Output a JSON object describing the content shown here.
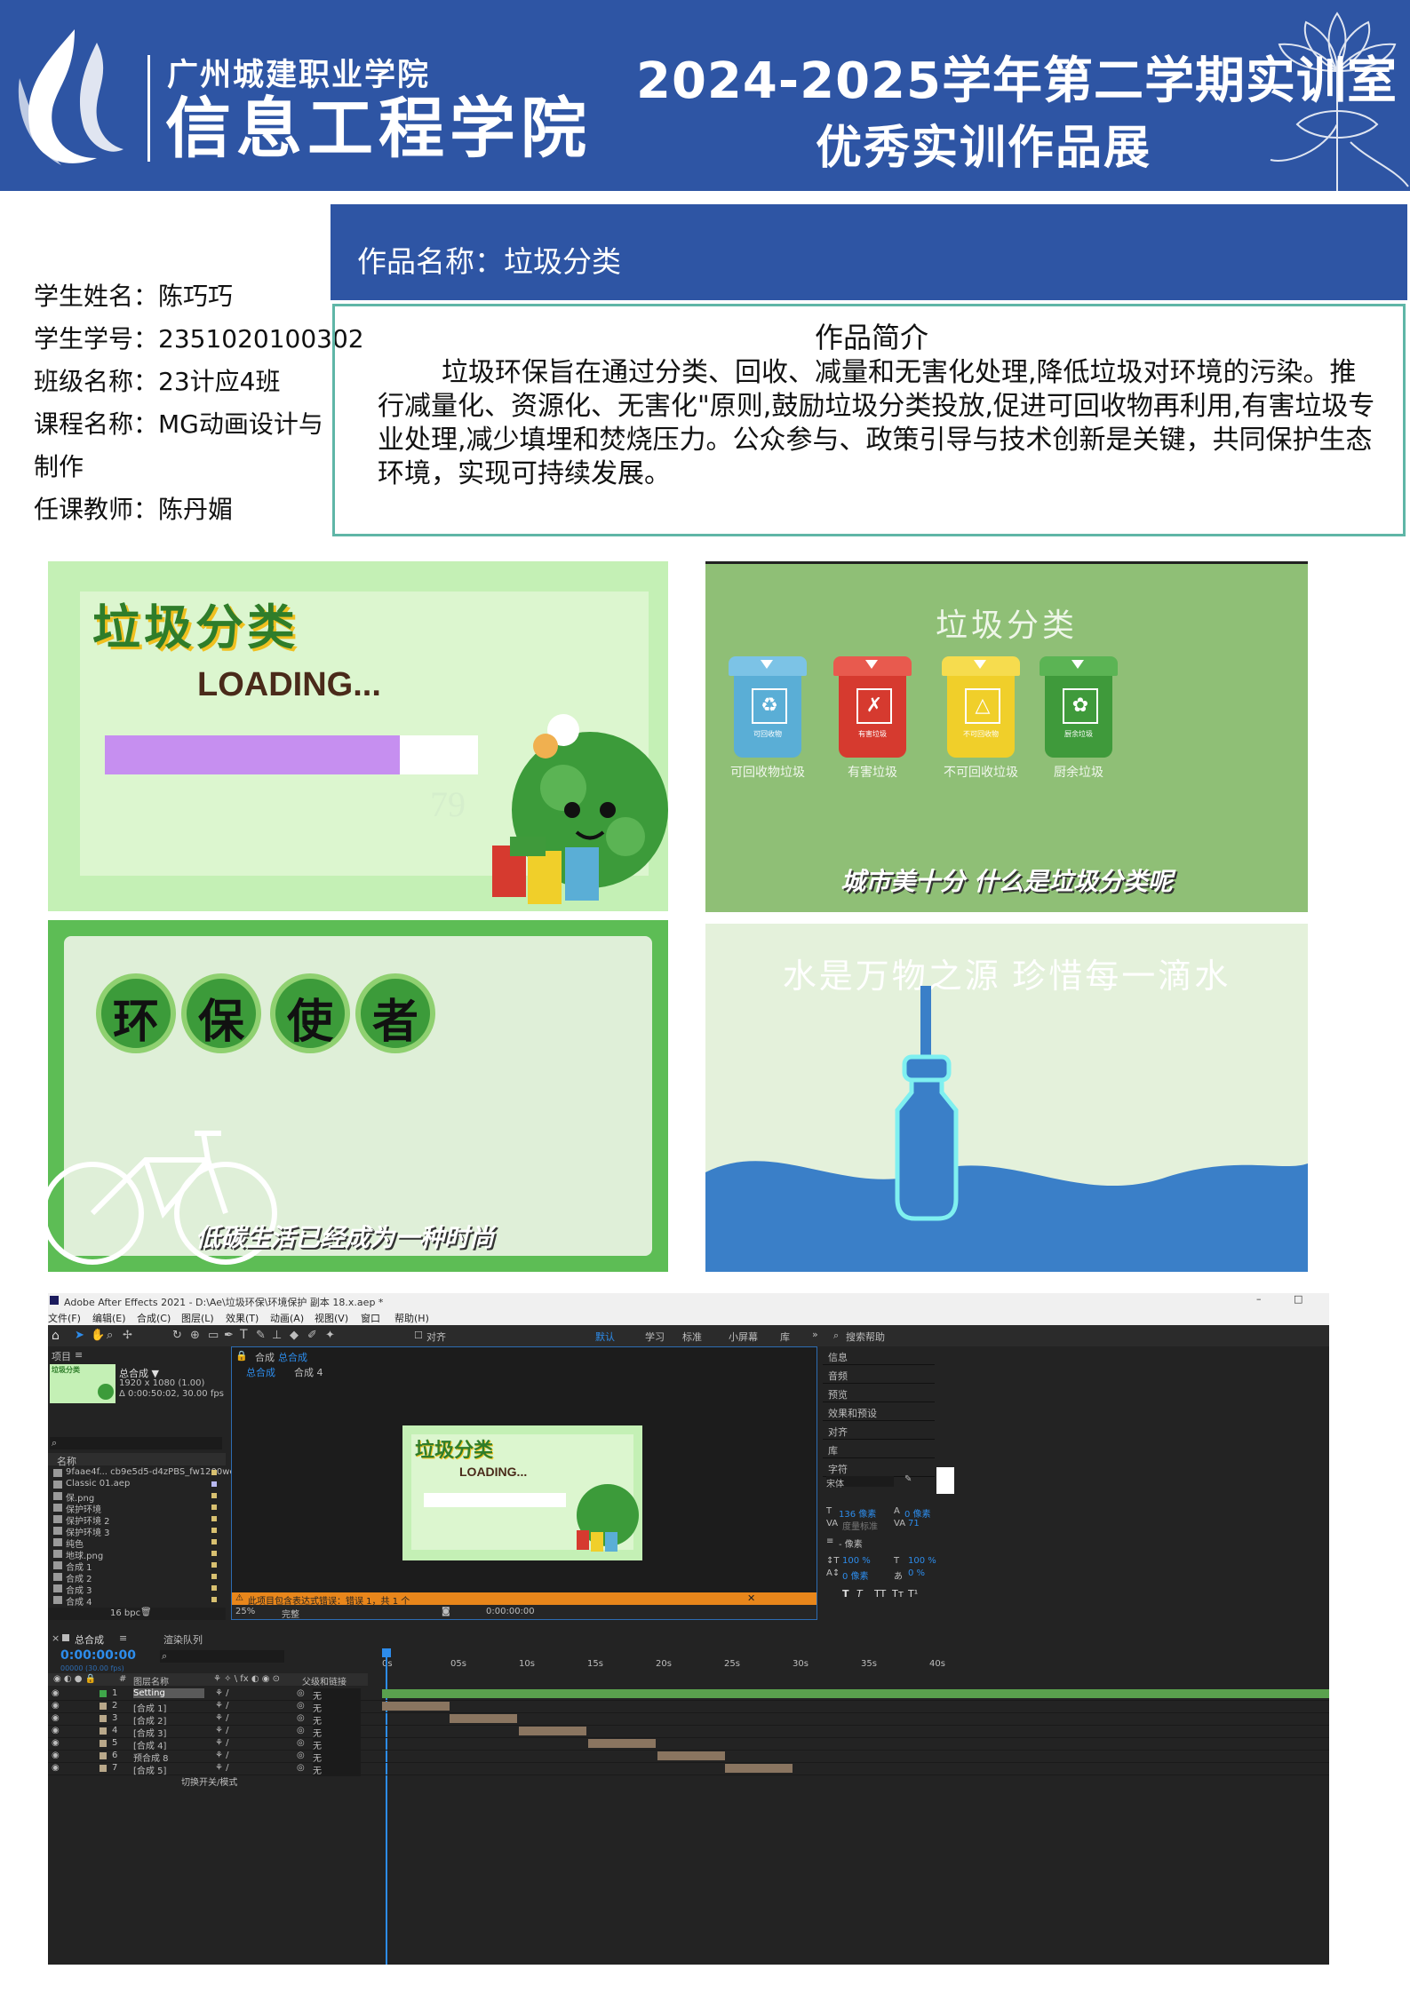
{
  "header": {
    "school": "广州城建职业学院",
    "college": "信息工程学院",
    "title_line1": "2024-2025学年第二学期实训室",
    "title_line2": "优秀实训作品展"
  },
  "work": {
    "name": "作品名称：垃圾分类"
  },
  "student": {
    "name": "学生姓名：陈巧巧",
    "id": "学生学号：2351020100302",
    "class": "班级名称：23计应4班",
    "course_line1": "课程名称：MG动画设计与",
    "course_line2": "制作",
    "teacher": "任课教师：陈丹媚"
  },
  "intro": {
    "heading": "作品简介",
    "text": "垃圾环保旨在通过分类、回收、减量和无害化处理,降低垃圾对环境的污染。推行减量化、资源化、无害化\"原则,鼓励垃圾分类投放,促进可回收物再利用,有害垃圾专业处理,减少填埋和焚烧压力。公众参与、政策引导与技术创新是关键，共同保护生态环境，实现可持续发展。"
  },
  "panel1": {
    "title": "垃圾分类",
    "loading": "LOADING...",
    "progress": 0.79,
    "percent": "79"
  },
  "panel2": {
    "title": "垃圾分类",
    "bins": [
      {
        "label": "可回收物垃圾",
        "inner": "可回收物",
        "color": "#5aaed6",
        "lid": "#7cc3e6",
        "symbol": "♻"
      },
      {
        "label": "有害垃圾",
        "inner": "有害垃圾",
        "color": "#d63a2f",
        "lid": "#e85a4e",
        "symbol": "✗"
      },
      {
        "label": "不可回收垃圾",
        "inner": "不可回收物",
        "color": "#f0cf2a",
        "lid": "#f6dc4e",
        "symbol": "△"
      },
      {
        "label": "厨余垃圾",
        "inner": "厨余垃圾",
        "color": "#3f9a3b",
        "lid": "#5bb454",
        "symbol": "✿"
      }
    ],
    "subtitle": "城市美十分 什么是垃圾分类呢"
  },
  "panel3": {
    "chars": [
      "环",
      "保",
      "使",
      "者"
    ],
    "subtitle": "低碳生活已经成为一种时尚"
  },
  "panel4": {
    "title": "水是万物之源 珍惜每一滴水"
  },
  "ae": {
    "title_bar": "Adobe After Effects 2021 - D:\\Ae\\垃圾环保\\环境保护 副本 18.x.aep *",
    "menu": [
      "文件(F)",
      "编辑(E)",
      "合成(C)",
      "图层(L)",
      "效果(T)",
      "动画(A)",
      "视图(V)",
      "窗口",
      "帮助(H)"
    ],
    "workspaces": [
      "默认",
      "学习",
      "标准",
      "小屏幕",
      "库"
    ],
    "search_help": "搜索帮助",
    "align_label": "对齐",
    "project_label": "项目",
    "comp_name": "总合成 ▼",
    "comp_info1": "1920 x 1080 (1.00)",
    "comp_info2": "Δ 0:00:50:02, 30.00 fps",
    "name_header": "名称",
    "project_items": [
      "9faae4f... cb9e5d5-d4zPBS_fw1200webp.webp",
      "Classic 01.aep",
      "保.png",
      "保护环境",
      "保护环境 2",
      "保护环境 3",
      "纯色",
      "地球.png",
      "合成 1",
      "合成 2",
      "合成 3",
      "合成 4",
      "合成 5"
    ],
    "bpc": "16 bpc",
    "comp_tab": "合成",
    "comp_tab_name": "总合成",
    "breadcrumb1": "总合成",
    "breadcrumb2": "合成 4",
    "preview_title": "垃圾分类",
    "preview_loading": "LOADING...",
    "warning": "此项目包含表达式错误：错误 1，共 1 个",
    "zoom": "25%",
    "quality": "完整",
    "comp_time": "0:00:00:00",
    "right_panels": [
      "信息",
      "音频",
      "预览",
      "效果和预设",
      "对齐",
      "库",
      "字符"
    ],
    "font": "宋体",
    "font_size": "136 像素",
    "leading": "0 像素",
    "tracking": "度量标准",
    "kerning": "71",
    "px_unit": "- 像素",
    "vscale": "100 %",
    "hscale": "100 %",
    "baseline": "0 像素",
    "tsume": "0 %",
    "timeline_tab": "总合成",
    "render_queue": "渲染队列",
    "timecode": "0:00:00:00",
    "timecode_sub": "00000 (30.00 fps)",
    "layer_header": "图层名称",
    "parent_header": "父级和链接",
    "ruler": [
      "0s",
      "05s",
      "10s",
      "15s",
      "20s",
      "25s",
      "30s",
      "35s",
      "40s"
    ],
    "layers": [
      {
        "num": "1",
        "name": "Setting",
        "parent": "无"
      },
      {
        "num": "2",
        "name": "[合成 1]",
        "parent": "无"
      },
      {
        "num": "3",
        "name": "[合成 2]",
        "parent": "无"
      },
      {
        "num": "4",
        "name": "[合成 3]",
        "parent": "无"
      },
      {
        "num": "5",
        "name": "[合成 4]",
        "parent": "无"
      },
      {
        "num": "6",
        "name": "预合成 8",
        "parent": "无"
      },
      {
        "num": "7",
        "name": "[合成 5]",
        "parent": "无"
      }
    ],
    "toggle_label": "切换开关/模式"
  },
  "colors": {
    "header_blue": "#2e55a4",
    "intro_border": "#5fb6a7",
    "ae_bg": "#232323",
    "ae_accent": "#2d8ceb"
  }
}
